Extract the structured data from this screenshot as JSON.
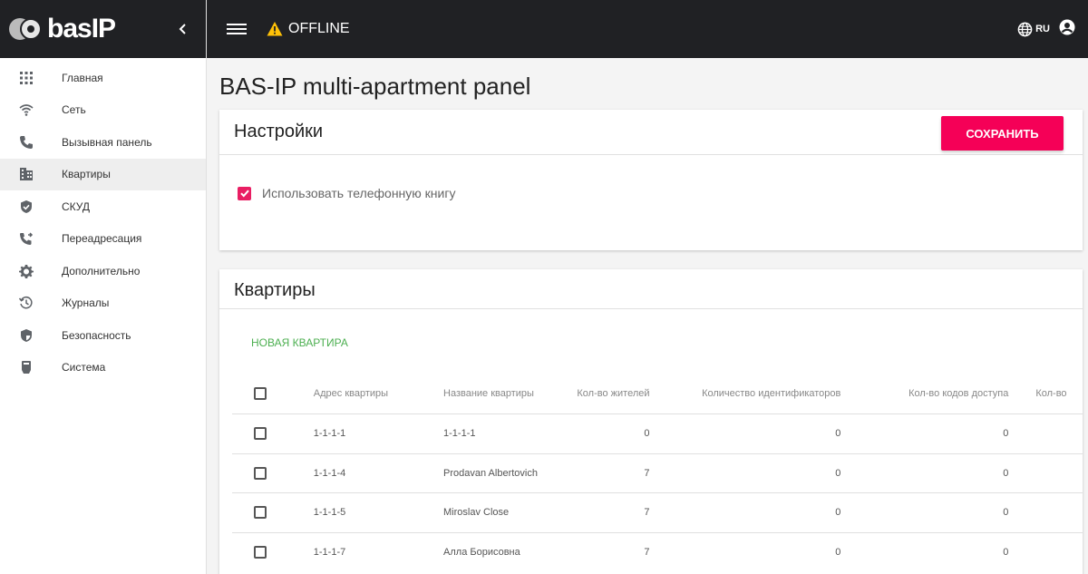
{
  "brand": {
    "logo_text": "basIP"
  },
  "topbar": {
    "status": "OFFLINE",
    "language": "RU"
  },
  "sidebar": {
    "items": [
      {
        "label": "Главная",
        "icon": "apps-icon"
      },
      {
        "label": "Сеть",
        "icon": "wifi-icon"
      },
      {
        "label": "Вызывная панель",
        "icon": "phone-icon"
      },
      {
        "label": "Квартиры",
        "icon": "building-icon",
        "active": true
      },
      {
        "label": "СКУД",
        "icon": "shield-check-icon"
      },
      {
        "label": "Переадресация",
        "icon": "phone-forward-icon"
      },
      {
        "label": "Дополнительно",
        "icon": "gear-icon"
      },
      {
        "label": "Журналы",
        "icon": "history-icon"
      },
      {
        "label": "Безопасность",
        "icon": "security-icon"
      },
      {
        "label": "Система",
        "icon": "device-icon"
      }
    ]
  },
  "page": {
    "title": "BAS-IP multi-apartment panel"
  },
  "settings": {
    "title": "Настройки",
    "save_label": "СОХРАНИТЬ",
    "phonebook_label": "Использовать телефонную книгу",
    "phonebook_checked": true
  },
  "apartments": {
    "title": "Квартиры",
    "new_label": "НОВАЯ КВАРТИРА",
    "columns": [
      "Адрес квартиры",
      "Название квартиры",
      "Кол-во жителей",
      "Количество идентификаторов",
      "Кол-во кодов доступа",
      "Кол-во"
    ],
    "rows": [
      {
        "address": "1-1-1-1",
        "name": "1-1-1-1",
        "residents": "0",
        "identifiers": "0",
        "codes": "0"
      },
      {
        "address": "1-1-1-4",
        "name": "Prodavan Albertovich",
        "residents": "7",
        "identifiers": "0",
        "codes": "0"
      },
      {
        "address": "1-1-1-5",
        "name": "Miroslav Close",
        "residents": "7",
        "identifiers": "0",
        "codes": "0"
      },
      {
        "address": "1-1-1-7",
        "name": "Алла Борисовна",
        "residents": "7",
        "identifiers": "0",
        "codes": "0"
      }
    ]
  },
  "colors": {
    "accent": "#f50057",
    "checkbox": "#e91e63",
    "link": "#4caf50",
    "topbar": "#202124"
  }
}
